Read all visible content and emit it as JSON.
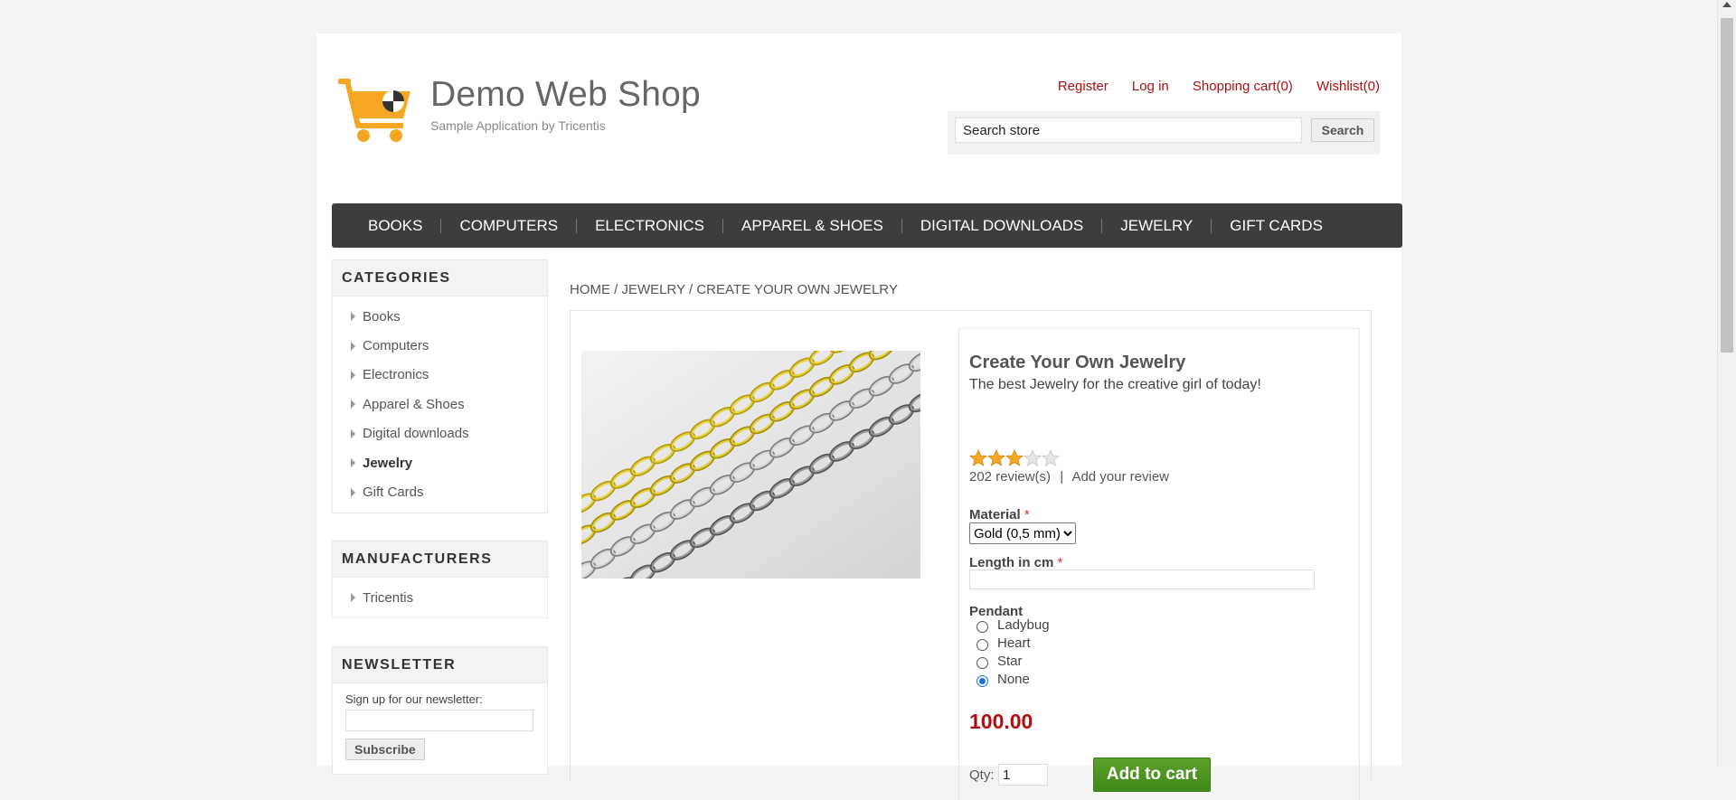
{
  "header": {
    "logo_title": "Demo Web Shop",
    "logo_subtitle": "Sample Application by Tricentis",
    "links": {
      "register": "Register",
      "login": "Log in",
      "cart": "Shopping cart(0)",
      "wishlist": "Wishlist(0)"
    },
    "search": {
      "value": "Search store",
      "button": "Search"
    }
  },
  "menu": [
    "BOOKS",
    "COMPUTERS",
    "ELECTRONICS",
    "APPAREL & SHOES",
    "DIGITAL DOWNLOADS",
    "JEWELRY",
    "GIFT CARDS"
  ],
  "sidebar": {
    "categories": {
      "title": "CATEGORIES",
      "items": [
        "Books",
        "Computers",
        "Electronics",
        "Apparel & Shoes",
        "Digital downloads",
        "Jewelry",
        "Gift Cards"
      ],
      "active": "Jewelry"
    },
    "manufacturers": {
      "title": "MANUFACTURERS",
      "items": [
        "Tricentis"
      ]
    },
    "newsletter": {
      "title": "NEWSLETTER",
      "label": "Sign up for our newsletter:",
      "button": "Subscribe"
    }
  },
  "breadcrumb": {
    "home": "HOME",
    "category": "JEWELRY",
    "current": "CREATE YOUR OWN JEWELRY",
    "sep": "/"
  },
  "product": {
    "name": "Create Your Own Jewelry",
    "short_description": "The best Jewelry for the creative girl of today!",
    "rating": 3,
    "rating_max": 5,
    "reviews_count": "202 review(s)",
    "reviews_sep": "|",
    "add_review": "Add your review",
    "material": {
      "label": "Material",
      "required": "*",
      "selected": "Gold (0,5 mm)"
    },
    "length": {
      "label": "Length in cm",
      "required": "*",
      "value": ""
    },
    "pendant": {
      "label": "Pendant",
      "options": [
        "Ladybug",
        "Heart",
        "Star",
        "None"
      ],
      "selected": "None"
    },
    "price": "100.00",
    "qty": {
      "label": "Qty:",
      "value": "1"
    },
    "add_to_cart": "Add to cart"
  },
  "colors": {
    "accent": "#b10f0f",
    "menu_bg": "#3d3d3d",
    "cart_button": "#4b9420",
    "star": "#f5a623"
  }
}
